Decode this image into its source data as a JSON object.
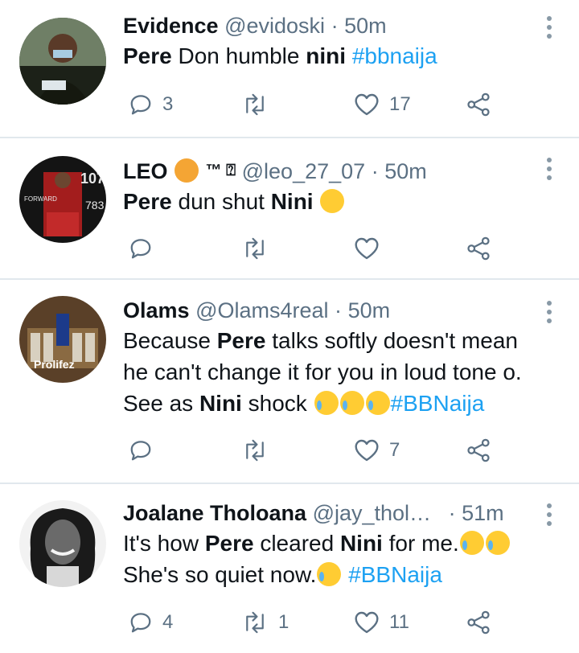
{
  "tweets": [
    {
      "name": "Evidence",
      "handle": "@evidoski",
      "time": "50m",
      "text": [
        {
          "t": "Pere",
          "b": true
        },
        {
          "t": " Don humble ",
          "b": false
        },
        {
          "t": "nini",
          "b": true
        },
        {
          "t": " ",
          "b": false
        },
        {
          "t": "#bbnaija",
          "h": true
        }
      ],
      "replies": "3",
      "retweets": "",
      "likes": "17"
    },
    {
      "name": "LEO",
      "name_suffix": "™ ⍰",
      "handle": "@leo_27_07",
      "time": "50m",
      "text": [
        {
          "t": "Pere",
          "b": true
        },
        {
          "t": " dun shut ",
          "b": false
        },
        {
          "t": "Nini",
          "b": true
        },
        {
          "t": " ",
          "b": false
        }
      ],
      "replies": "",
      "retweets": "",
      "likes": ""
    },
    {
      "name": "Olams",
      "handle": "@Olams4real",
      "time": "50m",
      "text": [
        {
          "t": "Because ",
          "b": false
        },
        {
          "t": "Pere",
          "b": true
        },
        {
          "t": " talks softly doesn't mean he can't change it for you in loud tone o. See as ",
          "b": false
        },
        {
          "t": "Nini",
          "b": true
        },
        {
          "t": " shock ",
          "b": false
        }
      ],
      "hashtag_after_emoji": "#BBNaija",
      "replies": "",
      "retweets": "",
      "likes": "7",
      "avatar_text": "Prolifez"
    },
    {
      "name": "Joalane Tholoana",
      "handle": "@jay_thol…",
      "time": "51m",
      "text": [
        {
          "t": "It's how ",
          "b": false
        },
        {
          "t": "Pere",
          "b": true
        },
        {
          "t": " cleared ",
          "b": false
        },
        {
          "t": "Nini",
          "b": true
        },
        {
          "t": " for me.",
          "b": false
        }
      ],
      "line2": "She's so quiet now.",
      "hashtag": "#BBNaija",
      "replies": "4",
      "retweets": "1",
      "likes": "11"
    }
  ],
  "icons": {
    "reply": "reply-icon",
    "retweet": "retweet-icon",
    "like": "heart-icon",
    "share": "share-icon",
    "more": "more-vertical-icon"
  },
  "colors": {
    "hashtag": "#1da1f2",
    "meta": "#5b7083",
    "icon": "#5b7083",
    "divider": "#e1e8ed"
  }
}
